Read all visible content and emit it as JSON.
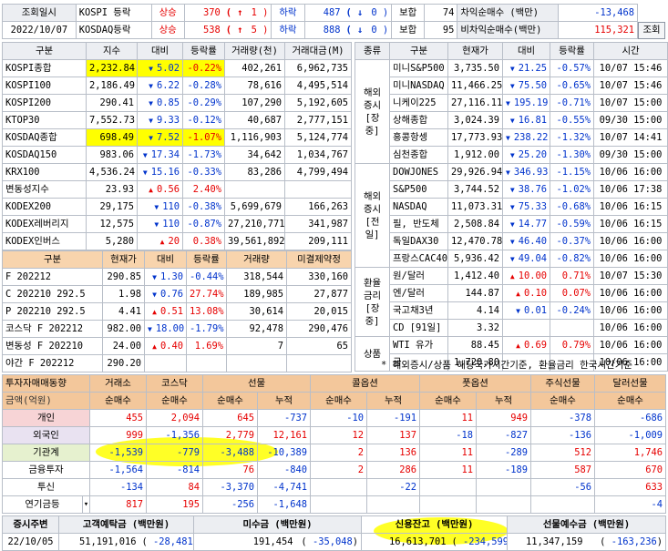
{
  "top": {
    "r1": {
      "label": "조회일시",
      "idx": "KOSPI 등락",
      "up_label": "상승",
      "up_count": "370",
      "up_arrow": "↑",
      "up_limit": "1",
      "down_label": "하락",
      "down_count": "487",
      "down_arrow": "↓",
      "down_limit": "0",
      "flat_label": "보합",
      "flat_count": "74",
      "arb_label": "차익순매수 (백만)",
      "arb_value": "-13,468"
    },
    "r2": {
      "date": "2022/10/07",
      "idx": "KOSDAQ등락",
      "up_label": "상승",
      "up_count": "538",
      "up_arrow": "↑",
      "up_limit": "5",
      "down_label": "하락",
      "down_count": "888",
      "down_arrow": "↓",
      "down_limit": "0",
      "flat_label": "보합",
      "flat_count": "95",
      "arb_label": "비차익순매수(백만)",
      "arb_value": "115,321",
      "button": "조회"
    }
  },
  "index_table": {
    "headers": [
      "구분",
      "지수",
      "대비",
      "등락률",
      "거래량(천)",
      "거래대금(M)"
    ],
    "rows": [
      {
        "name": "KOSPI종합",
        "value": "2,232.84",
        "dir": "▼",
        "change": "5.02",
        "rate": "-0.22%",
        "volume": "402,261",
        "amount": "6,962,735",
        "hl": true
      },
      {
        "name": "KOSPI100",
        "value": "2,186.49",
        "dir": "▼",
        "change": "6.22",
        "rate": "-0.28%",
        "volume": "78,616",
        "amount": "4,495,514"
      },
      {
        "name": "KOSPI200",
        "value": "290.41",
        "dir": "▼",
        "change": "0.85",
        "rate": "-0.29%",
        "volume": "107,290",
        "amount": "5,192,605"
      },
      {
        "name": "KTOP30",
        "value": "7,552.73",
        "dir": "▼",
        "change": "9.33",
        "rate": "-0.12%",
        "volume": "40,687",
        "amount": "2,777,151"
      },
      {
        "name": "KOSDAQ종합",
        "value": "698.49",
        "dir": "▼",
        "change": "7.52",
        "rate": "-1.07%",
        "volume": "1,116,903",
        "amount": "5,124,774",
        "hl": true
      },
      {
        "name": "KOSDAQ150",
        "value": "983.06",
        "dir": "▼",
        "change": "17.34",
        "rate": "-1.73%",
        "volume": "34,642",
        "amount": "1,034,767"
      },
      {
        "name": "KRX100",
        "value": "4,536.24",
        "dir": "▼",
        "change": "15.16",
        "rate": "-0.33%",
        "volume": "83,286",
        "amount": "4,799,494"
      },
      {
        "name": "변동성지수",
        "value": "23.93",
        "dir": "▲",
        "change": "0.56",
        "rate": "2.40%",
        "volume": "",
        "amount": ""
      },
      {
        "name": "KODEX200",
        "value": "29,175",
        "dir": "▼",
        "change": "110",
        "rate": "-0.38%",
        "volume": "5,699,679",
        "amount": "166,263"
      },
      {
        "name": "KODEX레버리지",
        "value": "12,575",
        "dir": "▼",
        "change": "110",
        "rate": "-0.87%",
        "volume": "27,210,771",
        "amount": "341,987"
      },
      {
        "name": "KODEX인버스",
        "value": "5,280",
        "dir": "▲",
        "change": "20",
        "rate": "0.38%",
        "volume": "39,561,892",
        "amount": "209,111"
      }
    ]
  },
  "futures_table": {
    "headers": [
      "구분",
      "현재가",
      "대비",
      "등락률",
      "거래량",
      "미결제약정"
    ],
    "rows": [
      {
        "name": "F 202212",
        "value": "290.85",
        "dir": "▼",
        "change": "1.30",
        "rate": "-0.44%",
        "volume": "318,544",
        "oi": "330,160"
      },
      {
        "name": "C 202210 292.5",
        "value": "1.98",
        "dir": "▼",
        "change": "0.76",
        "rate": "27.74%",
        "volume": "189,985",
        "oi": "27,877"
      },
      {
        "name": "P 202210 292.5",
        "value": "4.41",
        "dir": "▲",
        "change": "0.51",
        "rate": "13.08%",
        "volume": "30,614",
        "oi": "20,015"
      },
      {
        "name": "코스닥 F 202212",
        "value": "982.00",
        "dir": "▼",
        "change": "18.00",
        "rate": "-1.79%",
        "volume": "92,478",
        "oi": "290,476"
      },
      {
        "name": "변동성 F 202210",
        "value": "24.00",
        "dir": "▲",
        "change": "0.40",
        "rate": "1.69%",
        "volume": "7",
        "oi": "65"
      },
      {
        "name": "야간 F 202212",
        "value": "290.20",
        "dir": "",
        "change": "",
        "rate": "",
        "volume": "",
        "oi": ""
      }
    ]
  },
  "world_table": {
    "headers": [
      "종류",
      "구분",
      "현재가",
      "대비",
      "등락률",
      "시간"
    ],
    "groups": [
      {
        "label": "해외증시[장중]",
        "rows": [
          {
            "name": "미니S&P500",
            "value": "3,735.50",
            "dir": "▼",
            "change": "21.25",
            "rate": "-0.57%",
            "time": "10/07 15:46"
          },
          {
            "name": "미니NASDAQ",
            "value": "11,466.25",
            "dir": "▼",
            "change": "75.50",
            "rate": "-0.65%",
            "time": "10/07 15:46"
          },
          {
            "name": "니케이225",
            "value": "27,116.11",
            "dir": "▼",
            "change": "195.19",
            "rate": "-0.71%",
            "time": "10/07 15:00"
          },
          {
            "name": "상해종합",
            "value": "3,024.39",
            "dir": "▼",
            "change": "16.81",
            "rate": "-0.55%",
            "time": "09/30 15:00"
          },
          {
            "name": "홍콩항셍",
            "value": "17,773.93",
            "dir": "▼",
            "change": "238.22",
            "rate": "-1.32%",
            "time": "10/07 14:41"
          },
          {
            "name": "심천종합",
            "value": "1,912.00",
            "dir": "▼",
            "change": "25.20",
            "rate": "-1.30%",
            "time": "09/30 15:00"
          }
        ]
      },
      {
        "label": "해외증시[전일]",
        "rows": [
          {
            "name": "DOWJONES",
            "value": "29,926.94",
            "dir": "▼",
            "change": "346.93",
            "rate": "-1.15%",
            "time": "10/06 16:00"
          },
          {
            "name": "S&P500",
            "value": "3,744.52",
            "dir": "▼",
            "change": "38.76",
            "rate": "-1.02%",
            "time": "10/06 17:38"
          },
          {
            "name": "NASDAQ",
            "value": "11,073.31",
            "dir": "▼",
            "change": "75.33",
            "rate": "-0.68%",
            "time": "10/06 16:15"
          },
          {
            "name": "필, 반도체",
            "value": "2,508.84",
            "dir": "▼",
            "change": "14.77",
            "rate": "-0.59%",
            "time": "10/06 16:15"
          },
          {
            "name": "독일DAX30",
            "value": "12,470.78",
            "dir": "▼",
            "change": "46.40",
            "rate": "-0.37%",
            "time": "10/06 16:00"
          },
          {
            "name": "프랑스CAC40",
            "value": "5,936.42",
            "dir": "▼",
            "change": "49.04",
            "rate": "-0.82%",
            "time": "10/06 16:00"
          }
        ]
      },
      {
        "label": "환율금리[장중]",
        "rows": [
          {
            "name": "원/달러",
            "value": "1,412.40",
            "dir": "▲",
            "change": "10.00",
            "rate": "0.71%",
            "time": "10/07 15:30"
          },
          {
            "name": "엔/달러",
            "value": "144.87",
            "dir": "▲",
            "change": "0.10",
            "rate": "0.07%",
            "time": "10/06 16:00"
          },
          {
            "name": "국고채3년",
            "value": "4.14",
            "dir": "▼",
            "change": "0.01",
            "rate": "-0.24%",
            "time": "10/06 16:00"
          },
          {
            "name": "CD [91일]",
            "value": "3.32",
            "dir": "",
            "change": "",
            "rate": "",
            "time": "10/06 16:00"
          }
        ]
      },
      {
        "label": "상품",
        "rows": [
          {
            "name": "WTI 유가",
            "value": "88.45",
            "dir": "▲",
            "change": "0.69",
            "rate": "0.79%",
            "time": "10/06 16:00"
          },
          {
            "name": "금",
            "value": "1,720.80",
            "dir": "",
            "change": "",
            "rate": "",
            "time": "10/06 16:00"
          }
        ]
      }
    ],
    "note": "* 해외증시/상품 해당국가시간기준, 환율금리 한국시간기준"
  },
  "investor_table": {
    "title": "투자자매매동향",
    "groups": [
      "거래소",
      "코스닥",
      "선물",
      "콜옵션",
      "풋옵션",
      "주식선물",
      "달러선물"
    ],
    "unit_label": "금액(억원)",
    "subheaders": [
      "순매수",
      "순매수",
      "순매수",
      "누적",
      "순매수",
      "누적",
      "순매수",
      "누적",
      "순매수",
      "순매수"
    ],
    "rows": [
      {
        "name": "개인",
        "values": [
          "455",
          "2,094",
          "645",
          "-737",
          "-10",
          "-191",
          "11",
          "949",
          "-378",
          "-686"
        ],
        "cls": "pink"
      },
      {
        "name": "외국인",
        "values": [
          "999",
          "-1,356",
          "2,779",
          "12,161",
          "12",
          "137",
          "-18",
          "-827",
          "-136",
          "-1,009"
        ],
        "cls": "lav"
      },
      {
        "name": "기관계",
        "values": [
          "-1,539",
          "-779",
          "-3,488",
          "-10,389",
          "2",
          "136",
          "11",
          "-289",
          "512",
          "1,746"
        ],
        "cls": "green"
      },
      {
        "name": "금융투자",
        "values": [
          "-1,564",
          "-814",
          "76",
          "-840",
          "2",
          "286",
          "11",
          "-189",
          "587",
          "670"
        ],
        "cls": ""
      },
      {
        "name": "투신",
        "values": [
          "-134",
          "84",
          "-3,370",
          "-4,741",
          "",
          "-22",
          "",
          "",
          "-56",
          "633"
        ],
        "cls": ""
      },
      {
        "name": "연기금등",
        "values": [
          "817",
          "195",
          "-256",
          "-1,648",
          "",
          "",
          "",
          "",
          "",
          "-4"
        ],
        "cls": ""
      }
    ]
  },
  "deposit_table": {
    "headers": [
      "증시주변",
      "고객예탁금 (백만원)",
      "미수금 (백만원)",
      "신용잔고 (백만원)",
      "선물예수금 (백만원)"
    ],
    "date": "22/10/05",
    "customer_deposit": "51,191,016",
    "customer_deposit_change": "-28,481",
    "receivable": "191,454",
    "receivable_change": "-35,048",
    "credit": "16,613,701",
    "credit_change": "-234,599",
    "futures_deposit": "11,347,159",
    "futures_deposit_change": "-163,236"
  }
}
